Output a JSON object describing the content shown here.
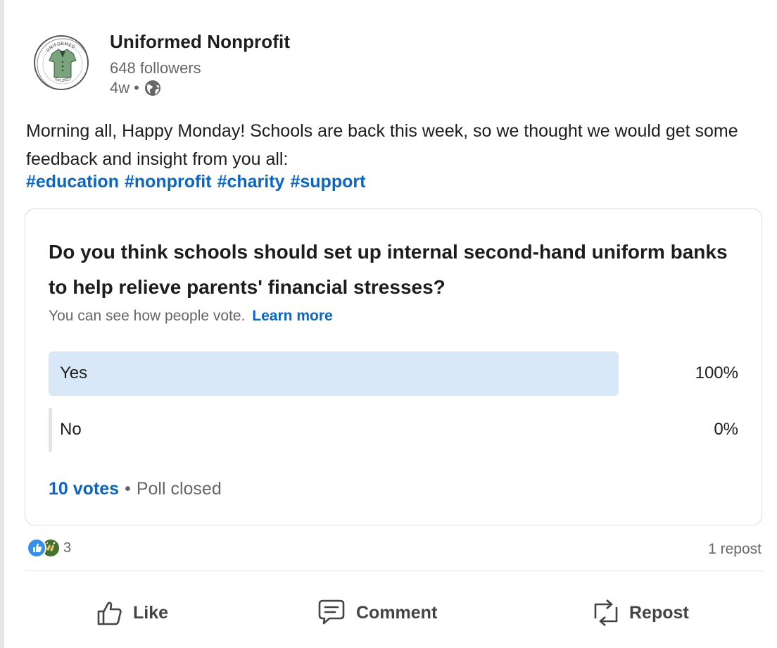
{
  "post": {
    "author": {
      "name": "Uniformed Nonprofit",
      "followers": "648 followers",
      "age": "4w",
      "separator": "•",
      "visibility_icon": "globe-icon",
      "logo_top_text": "UNIFORMED",
      "logo_bottom_text": "Est.2022"
    },
    "text": "Morning all, Happy Monday! Schools are back this week, so we thought we would get some feedback and insight from you all:",
    "hashtags": [
      "#education",
      "#nonprofit",
      "#charity",
      "#support"
    ]
  },
  "poll": {
    "question": "Do you think schools should set up internal second-hand uniform banks to help relieve parents' financial stresses?",
    "visibility_note": "You can see how people vote.",
    "learn_more": "Learn more",
    "options": [
      {
        "label": "Yes",
        "percent_text": "100%",
        "percent": 100
      },
      {
        "label": "No",
        "percent_text": "0%",
        "percent": 0
      }
    ],
    "votes": "10 votes",
    "separator": "•",
    "status": "Poll closed"
  },
  "engagement": {
    "reaction_icons": [
      "like-reaction-icon",
      "celebrate-reaction-icon"
    ],
    "reaction_count": "3",
    "reposts": "1 repost"
  },
  "actions": {
    "like": "Like",
    "comment": "Comment",
    "repost": "Repost"
  },
  "colors": {
    "accent": "#0a66c2",
    "poll_bar_selected": "#d9e8f9",
    "logo_shirt": "#7aa37e"
  }
}
